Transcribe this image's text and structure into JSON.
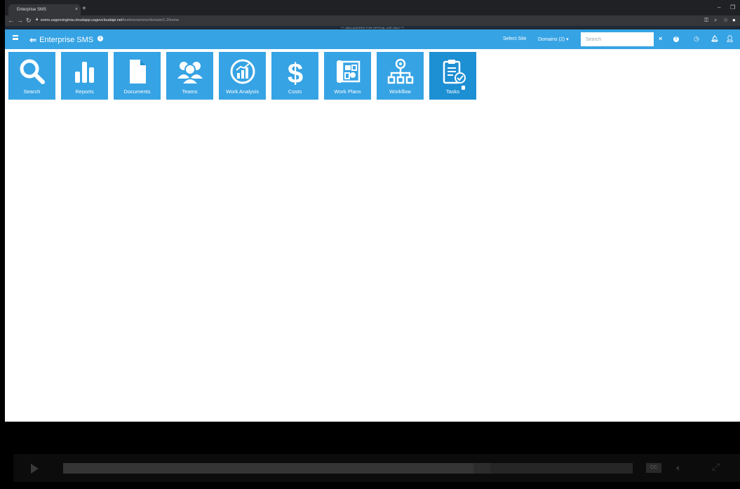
{
  "browser": {
    "tab_title": "Enterprise SMS",
    "tab_close": "×",
    "new_tab": "+",
    "url_host": "esms.usgovvirginia.cloudapp.usgovcloudapi.net",
    "url_path": "/test/esms/sms/domain/1.2/home",
    "banner": "*** UNCLASSIFIED FOR OFFICIAL USE ONLY ***"
  },
  "header": {
    "app_name": "Enterprise SMS",
    "select_site": "Select Site",
    "domains": "Domains (2) ▾",
    "search_placeholder": "Search",
    "clear": "×"
  },
  "tiles": [
    {
      "label": "Search",
      "icon": "search-icon"
    },
    {
      "label": "Reports",
      "icon": "bar-chart-icon"
    },
    {
      "label": "Documents",
      "icon": "document-icon"
    },
    {
      "label": "Teams",
      "icon": "people-icon"
    },
    {
      "label": "Work Analysis",
      "icon": "analysis-icon"
    },
    {
      "label": "Costs",
      "icon": "dollar-icon"
    },
    {
      "label": "Work Plans",
      "icon": "blueprint-icon"
    },
    {
      "label": "Workflow",
      "icon": "workflow-icon"
    },
    {
      "label": "Tasks",
      "icon": "clipboard-check-icon"
    }
  ],
  "player": {
    "cc_label": "CC",
    "progress": 0.72,
    "buffered": 0.75
  },
  "colors": {
    "accent": "#36a3e4",
    "tile_active": "#1d8fd3"
  }
}
